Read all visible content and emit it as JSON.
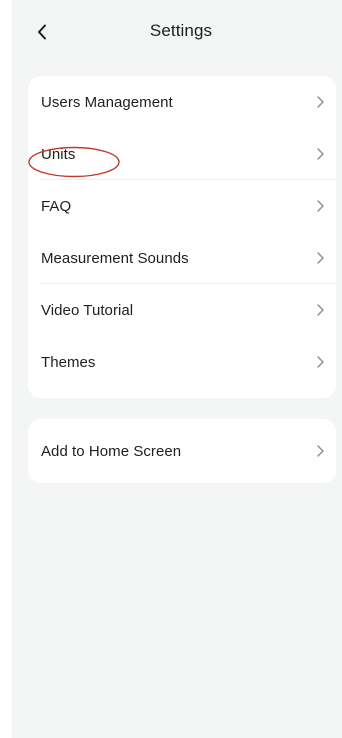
{
  "header": {
    "title": "Settings",
    "back_icon": "chevron-left-icon"
  },
  "settings_list": {
    "items": [
      {
        "label": "Users Management",
        "icon": "chevron-right-icon"
      },
      {
        "label": "Units",
        "icon": "chevron-right-icon"
      },
      {
        "label": "FAQ",
        "icon": "chevron-right-icon"
      },
      {
        "label": "Measurement Sounds",
        "icon": "chevron-right-icon"
      },
      {
        "label": "Video Tutorial",
        "icon": "chevron-right-icon"
      },
      {
        "label": "Themes",
        "icon": "chevron-right-icon"
      }
    ]
  },
  "extra_list": {
    "items": [
      {
        "label": "Add to Home Screen",
        "icon": "chevron-right-icon"
      }
    ]
  },
  "colors": {
    "background": "#f4f6f6",
    "card": "#ffffff",
    "text": "#1f1f1f",
    "chevron": "#8a8a8a",
    "highlight": "#c0392b"
  }
}
